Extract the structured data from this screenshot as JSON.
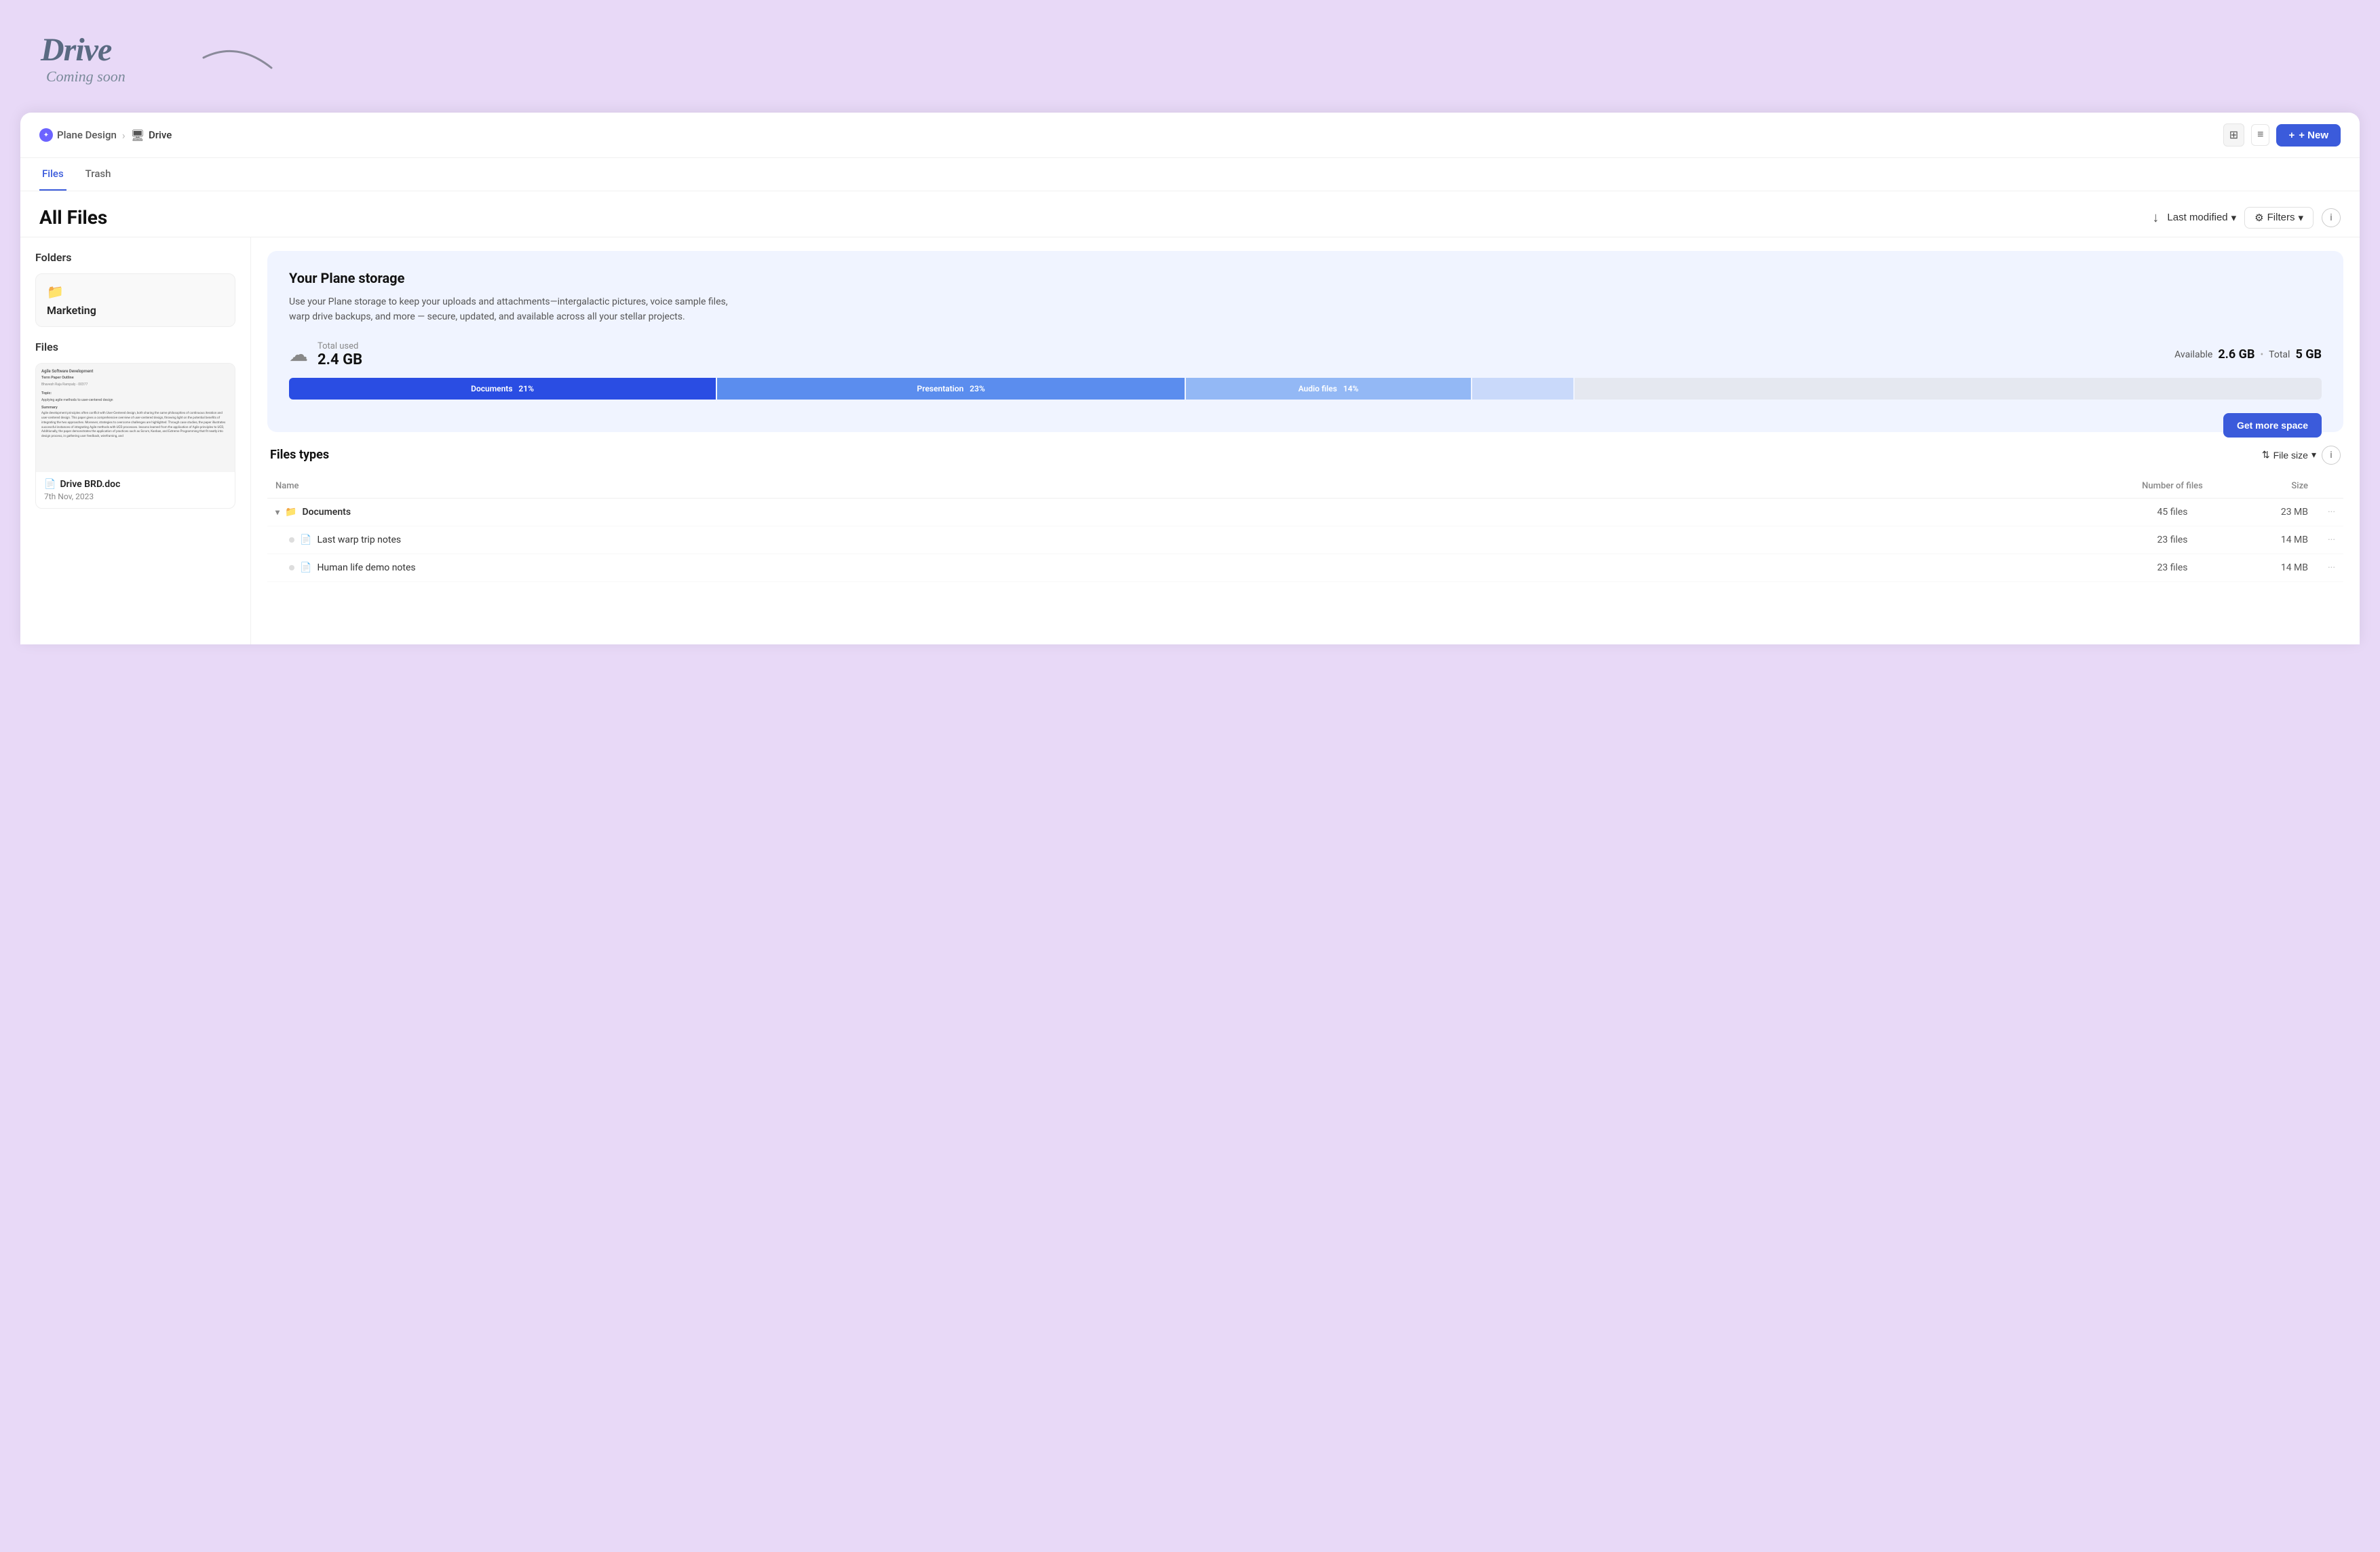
{
  "brand": {
    "logo": "Drive",
    "tagline": "Coming soon"
  },
  "breadcrumb": {
    "workspace": "Plane Design",
    "separator": "›",
    "current": "Drive",
    "drive_icon": "🖥"
  },
  "nav": {
    "new_label": "+ New",
    "view_grid_label": "⊞",
    "view_list_label": "≡"
  },
  "tabs": [
    {
      "id": "files",
      "label": "Files",
      "active": true
    },
    {
      "id": "trash",
      "label": "Trash",
      "active": false
    }
  ],
  "page": {
    "title": "All Files",
    "sort_arrow": "↓",
    "last_modified_label": "Last modified",
    "filters_label": "Filters"
  },
  "folders_section": {
    "title": "Folders",
    "items": [
      {
        "name": "Marketing"
      }
    ]
  },
  "files_section": {
    "title": "Files",
    "items": [
      {
        "name": "Drive BRD.doc",
        "date": "7th Nov, 2023",
        "preview_lines": [
          "Agile Software Development",
          "Term Paper Outline",
          "Bhavesh Raja Rampaly - 00377",
          "",
          "Topic:",
          "Applying agile methods to user-centered design",
          "",
          "Summary",
          "Agile development principles often conflict with User-Centered design",
          "both sharing the same philosophies of continuous iteration and",
          "user-centered design. This paper gives a comprehensive overview of",
          "user-centered design, throwing light on the potential benefits of",
          "integrating the two approaches. Moreover, strategies to overcome",
          "challenges are highlighted. Through case studies, the paper illustrates",
          "successful instances of integrating Agile methods with UCD processes.",
          "lessons learned from the application of Agile principles to UCD,",
          "Additionally, the paper demonstrates the application of practices",
          "such as Scrum, Kanban, and Extreme Programming that fit neatly into",
          "design process, in gathering user feedback, wireframing, and"
        ]
      }
    ]
  },
  "storage": {
    "title": "Your Plane storage",
    "description": "Use your Plane storage to keep your uploads and attachments—intergalactic pictures, voice sample files, warp drive backups, and more — secure, updated, and available across all your stellar projects.",
    "total_used_label": "Total used",
    "total_used_value": "2.4 GB",
    "available_label": "Available",
    "available_value": "2.6 GB",
    "total_label": "Total",
    "total_value": "5 GB",
    "bar_segments": [
      {
        "label": "Documents",
        "percent": "21%",
        "width": 21,
        "class": "bar-docs"
      },
      {
        "label": "Presentation",
        "percent": "23%",
        "width": 23,
        "class": "bar-presentation"
      },
      {
        "label": "Audio files",
        "percent": "14%",
        "width": 14,
        "class": "bar-audio"
      },
      {
        "label": "",
        "percent": "",
        "width": 5,
        "class": "bar-other"
      }
    ],
    "get_more_label": "Get more space"
  },
  "file_types": {
    "title": "Files types",
    "sort_label": "File size",
    "col_name": "Name",
    "col_files": "Number of files",
    "col_size": "Size",
    "rows": [
      {
        "name": "Documents",
        "files": "45 files",
        "size": "23 MB",
        "expanded": true,
        "children": [
          {
            "name": "Last warp trip notes",
            "files": "23 files",
            "size": "14 MB"
          },
          {
            "name": "Human life demo notes",
            "files": "23 files",
            "size": "14 MB"
          }
        ]
      }
    ]
  }
}
